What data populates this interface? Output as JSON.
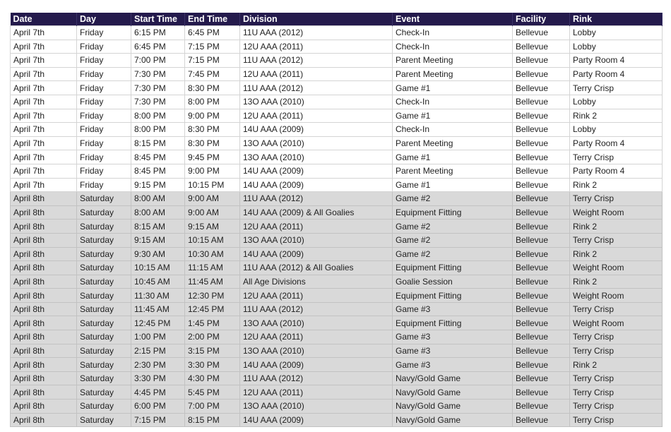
{
  "columns": [
    "Date",
    "Day",
    "Start Time",
    "End Time",
    "Division",
    "Event",
    "Facility",
    "Rink"
  ],
  "rows": [
    [
      "April 7th",
      "Friday",
      "6:15 PM",
      "6:45 PM",
      "11U AAA (2012)",
      "Check-In",
      "Bellevue",
      "Lobby"
    ],
    [
      "April 7th",
      "Friday",
      "6:45 PM",
      "7:15 PM",
      "12U AAA (2011)",
      "Check-In",
      "Bellevue",
      "Lobby"
    ],
    [
      "April 7th",
      "Friday",
      "7:00 PM",
      "7:15 PM",
      "11U AAA (2012)",
      "Parent Meeting",
      "Bellevue",
      "Party Room 4"
    ],
    [
      "April 7th",
      "Friday",
      "7:30 PM",
      "7:45 PM",
      "12U AAA (2011)",
      "Parent Meeting",
      "Bellevue",
      "Party Room 4"
    ],
    [
      "April 7th",
      "Friday",
      "7:30 PM",
      "8:30 PM",
      "11U AAA (2012)",
      "Game #1",
      "Bellevue",
      "Terry Crisp"
    ],
    [
      "April 7th",
      "Friday",
      "7:30 PM",
      "8:00 PM",
      "13O AAA (2010)",
      "Check-In",
      "Bellevue",
      "Lobby"
    ],
    [
      "April 7th",
      "Friday",
      "8:00 PM",
      "9:00 PM",
      "12U AAA (2011)",
      "Game #1",
      "Bellevue",
      "Rink 2"
    ],
    [
      "April 7th",
      "Friday",
      "8:00 PM",
      "8:30 PM",
      "14U AAA (2009)",
      "Check-In",
      "Bellevue",
      "Lobby"
    ],
    [
      "April 7th",
      "Friday",
      "8:15 PM",
      "8:30 PM",
      "13O AAA (2010)",
      "Parent Meeting",
      "Bellevue",
      "Party Room 4"
    ],
    [
      "April 7th",
      "Friday",
      "8:45 PM",
      "9:45 PM",
      "13O AAA (2010)",
      "Game #1",
      "Bellevue",
      "Terry Crisp"
    ],
    [
      "April 7th",
      "Friday",
      "8:45 PM",
      "9:00 PM",
      "14U AAA (2009)",
      "Parent Meeting",
      "Bellevue",
      "Party Room 4"
    ],
    [
      "April 7th",
      "Friday",
      "9:15 PM",
      "10:15 PM",
      "14U AAA (2009)",
      "Game #1",
      "Bellevue",
      "Rink 2"
    ],
    [
      "April 8th",
      "Saturday",
      "8:00 AM",
      "9:00 AM",
      "11U AAA (2012)",
      "Game #2",
      "Bellevue",
      "Terry Crisp"
    ],
    [
      "April 8th",
      "Saturday",
      "8:00 AM",
      "9:00 AM",
      "14U AAA (2009) & All Goalies",
      "Equipment Fitting",
      "Bellevue",
      "Weight Room"
    ],
    [
      "April 8th",
      "Saturday",
      "8:15 AM",
      "9:15 AM",
      "12U AAA (2011)",
      "Game #2",
      "Bellevue",
      "Rink 2"
    ],
    [
      "April 8th",
      "Saturday",
      "9:15 AM",
      "10:15 AM",
      "13O AAA (2010)",
      "Game #2",
      "Bellevue",
      "Terry Crisp"
    ],
    [
      "April 8th",
      "Saturday",
      "9:30 AM",
      "10:30 AM",
      "14U AAA (2009)",
      "Game #2",
      "Bellevue",
      "Rink 2"
    ],
    [
      "April 8th",
      "Saturday",
      "10:15 AM",
      "11:15 AM",
      "11U AAA (2012) & All Goalies",
      "Equipment Fitting",
      "Bellevue",
      "Weight Room"
    ],
    [
      "April 8th",
      "Saturday",
      "10:45 AM",
      "11:45 AM",
      "All Age Divisions",
      "Goalie Session",
      "Bellevue",
      "Rink 2"
    ],
    [
      "April 8th",
      "Saturday",
      "11:30 AM",
      "12:30 PM",
      "12U AAA (2011)",
      "Equipment Fitting",
      "Bellevue",
      "Weight Room"
    ],
    [
      "April 8th",
      "Saturday",
      "11:45 AM",
      "12:45 PM",
      "11U AAA (2012)",
      "Game #3",
      "Bellevue",
      "Terry Crisp"
    ],
    [
      "April 8th",
      "Saturday",
      "12:45 PM",
      "1:45 PM",
      "13O AAA (2010)",
      "Equipment Fitting",
      "Bellevue",
      "Weight Room"
    ],
    [
      "April 8th",
      "Saturday",
      "1:00 PM",
      "2:00 PM",
      "12U AAA (2011)",
      "Game #3",
      "Bellevue",
      "Terry Crisp"
    ],
    [
      "April 8th",
      "Saturday",
      "2:15 PM",
      "3:15 PM",
      "13O AAA (2010)",
      "Game #3",
      "Bellevue",
      "Terry Crisp"
    ],
    [
      "April 8th",
      "Saturday",
      "2:30 PM",
      "3:30 PM",
      "14U AAA (2009)",
      "Game #3",
      "Bellevue",
      "Rink 2"
    ],
    [
      "April 8th",
      "Saturday",
      "3:30 PM",
      "4:30 PM",
      "11U AAA (2012)",
      "Navy/Gold Game",
      "Bellevue",
      "Terry Crisp"
    ],
    [
      "April 8th",
      "Saturday",
      "4:45 PM",
      "5:45 PM",
      "12U AAA (2011)",
      "Navy/Gold Game",
      "Bellevue",
      "Terry Crisp"
    ],
    [
      "April 8th",
      "Saturday",
      "6:00 PM",
      "7:00 PM",
      "13O AAA (2010)",
      "Navy/Gold Game",
      "Bellevue",
      "Terry Crisp"
    ],
    [
      "April 8th",
      "Saturday",
      "7:15 PM",
      "8:15 PM",
      "14U AAA (2009)",
      "Navy/Gold Game",
      "Bellevue",
      "Terry Crisp"
    ]
  ],
  "colors": {
    "header_bg": "#241a4c",
    "header_text": "#ffffff",
    "friday_row_bg": "#ffffff",
    "saturday_row_bg": "#d9d9d9"
  }
}
